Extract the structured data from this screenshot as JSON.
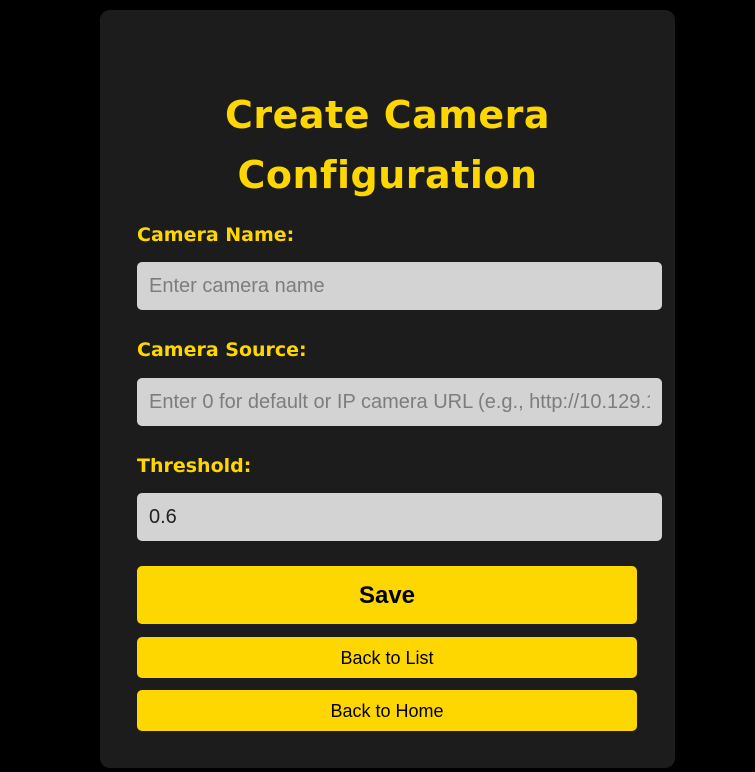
{
  "form": {
    "title_line1": "Create Camera",
    "title_line2": "Configuration",
    "camera_name": {
      "label": "Camera Name:",
      "placeholder": "Enter camera name",
      "value": ""
    },
    "camera_source": {
      "label": "Camera Source:",
      "placeholder": "Enter 0 for default or IP camera URL (e.g., http://10.129.1",
      "value": ""
    },
    "threshold": {
      "label": "Threshold:",
      "value": "0.6"
    },
    "buttons": {
      "save": "Save",
      "back_to_list": "Back to List",
      "back_to_home": "Back to Home"
    }
  },
  "colors": {
    "background": "#000000",
    "card": "#1c1c1c",
    "accent": "#ffd700",
    "input_bg": "#d3d3d3"
  }
}
